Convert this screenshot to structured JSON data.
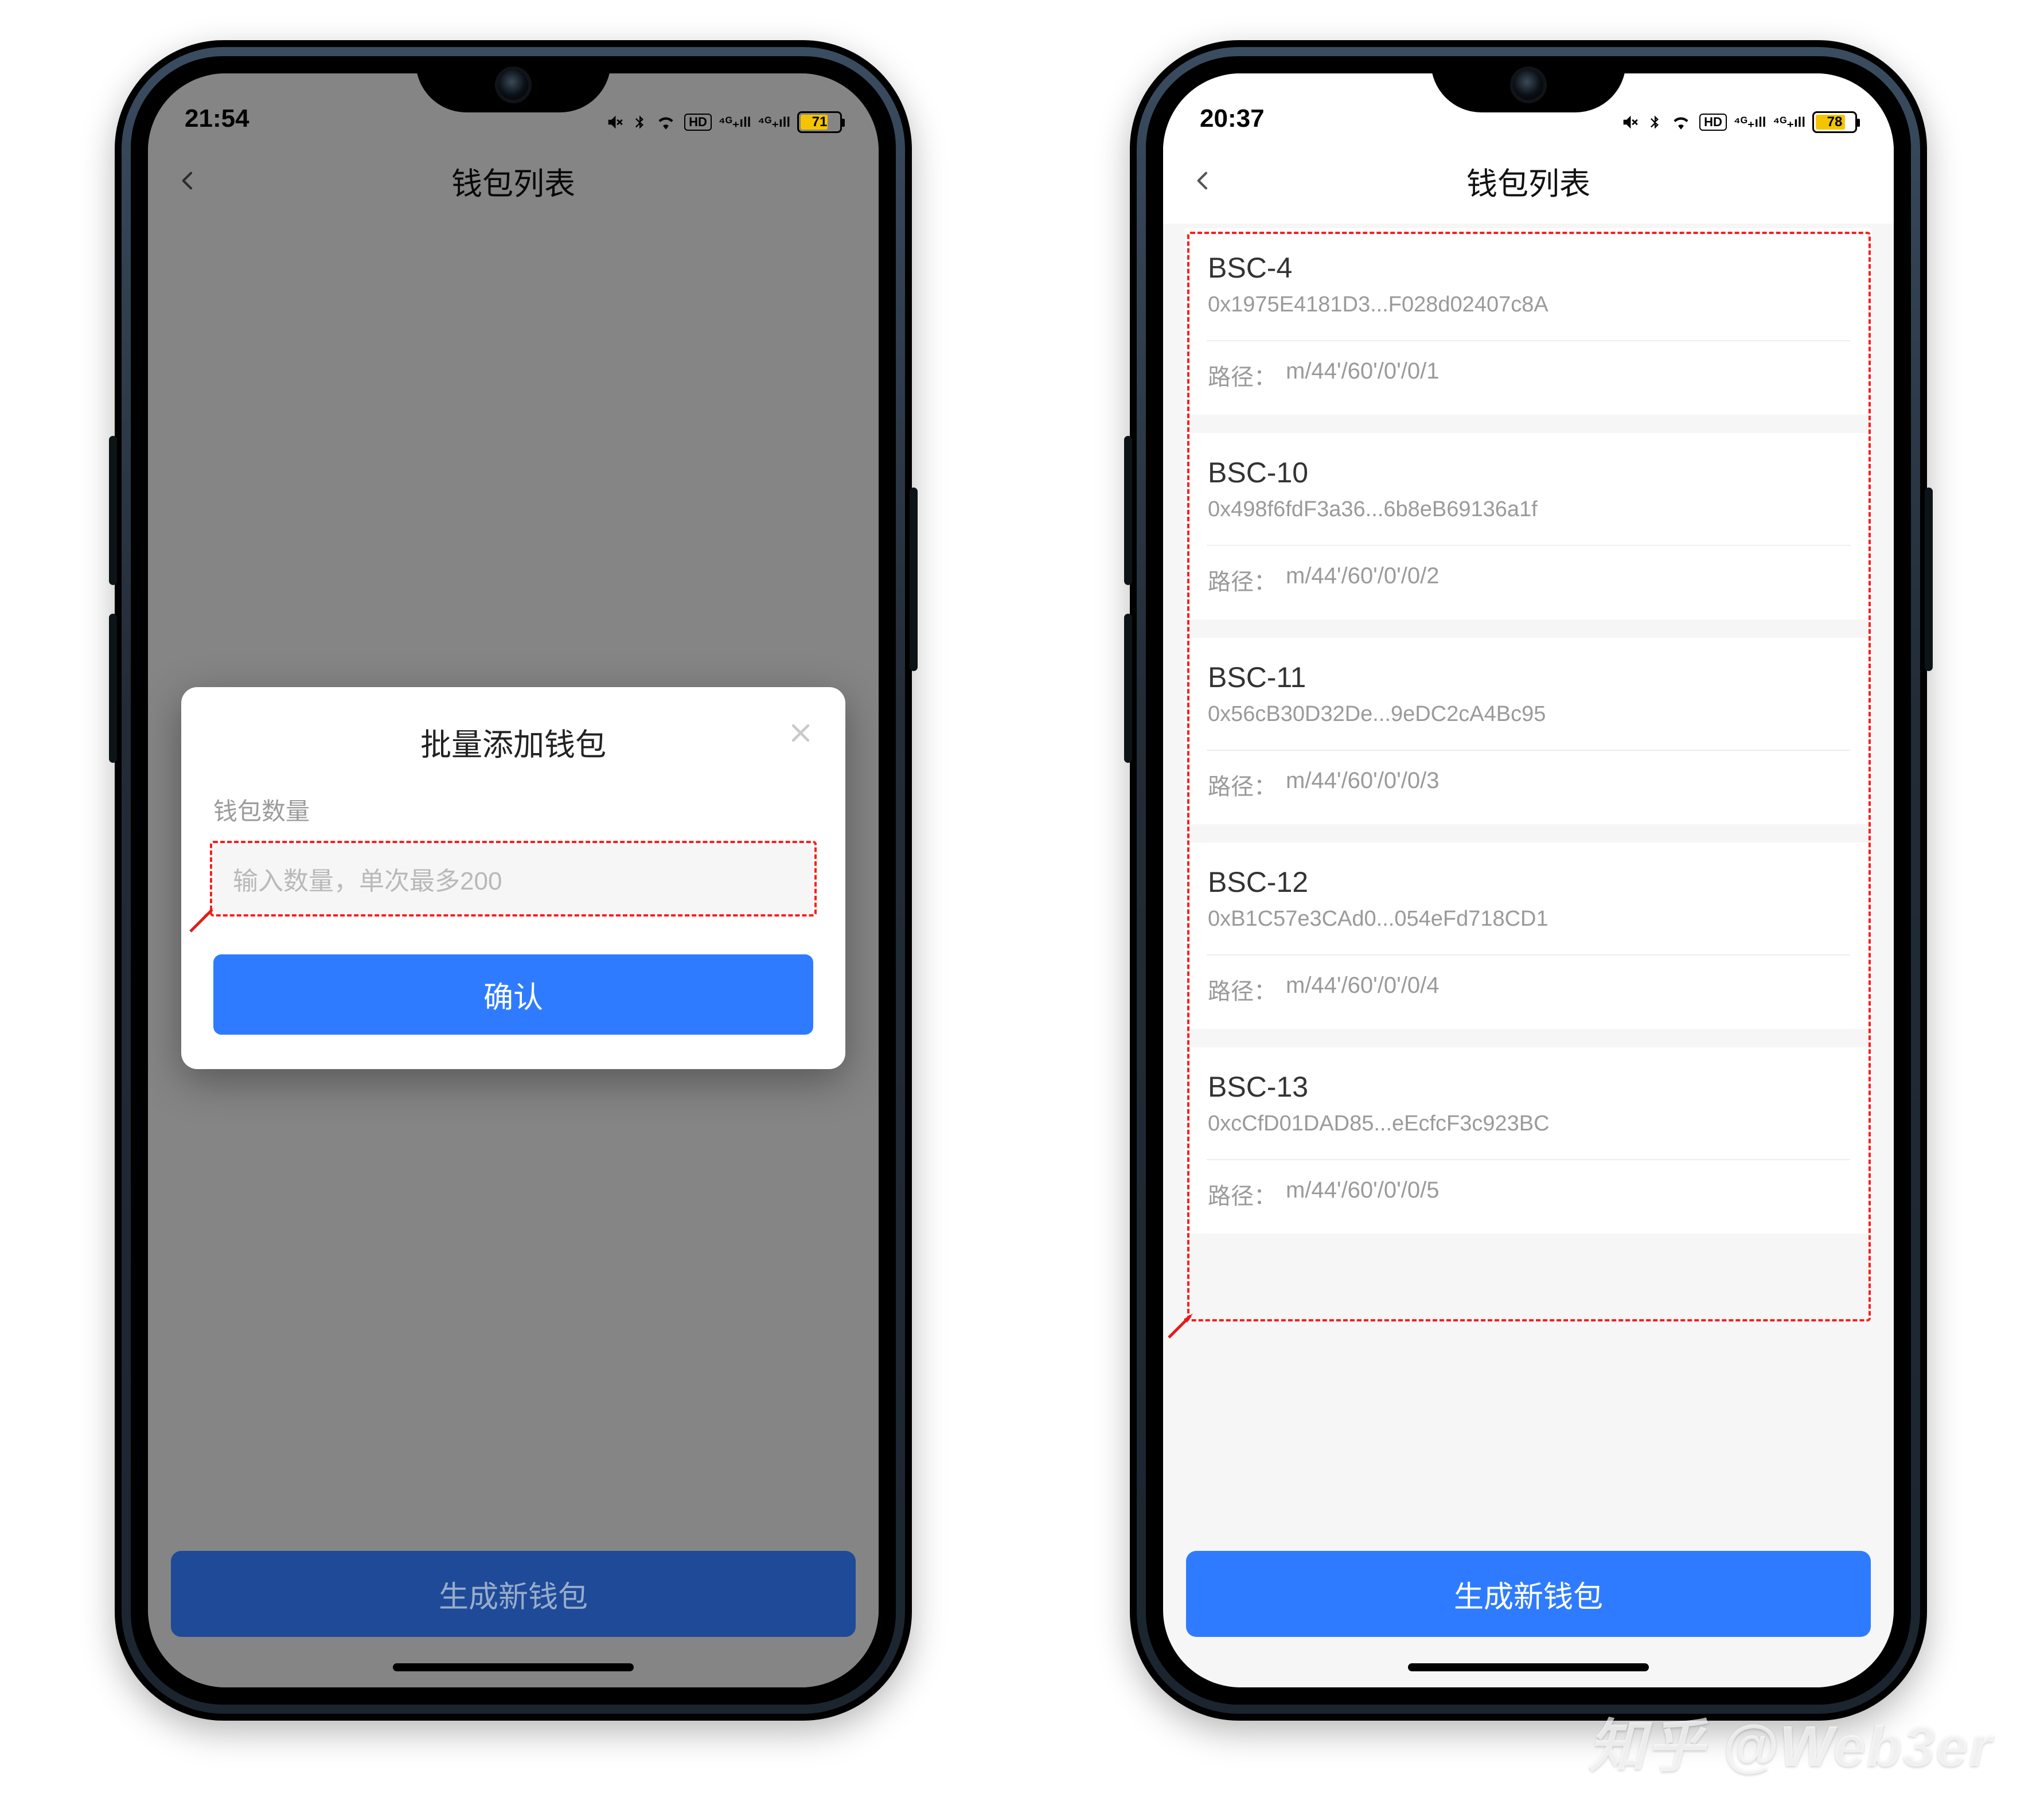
{
  "watermark": "知乎 @Web3er",
  "phone1": {
    "status": {
      "time": "21:54",
      "battery": "71",
      "battery_pct": 71
    },
    "nav": {
      "title": "钱包列表"
    },
    "footer_btn": "生成新钱包",
    "modal": {
      "title": "批量添加钱包",
      "label": "钱包数量",
      "placeholder": "输入数量，单次最多200",
      "confirm": "确认"
    }
  },
  "phone2": {
    "status": {
      "time": "20:37",
      "battery": "78",
      "battery_pct": 78
    },
    "nav": {
      "title": "钱包列表"
    },
    "footer_btn": "生成新钱包",
    "path_label": "路径：",
    "wallets": [
      {
        "name": "BSC-4",
        "addr": "0x1975E4181D3...F028d02407c8A",
        "path": "m/44'/60'/0'/0/1"
      },
      {
        "name": "BSC-10",
        "addr": "0x498f6fdF3a36...6b8eB69136a1f",
        "path": "m/44'/60'/0'/0/2"
      },
      {
        "name": "BSC-11",
        "addr": "0x56cB30D32De...9eDC2cA4Bc95",
        "path": "m/44'/60'/0'/0/3"
      },
      {
        "name": "BSC-12",
        "addr": "0xB1C57e3CAd0...054eFd718CD1",
        "path": "m/44'/60'/0'/0/4"
      },
      {
        "name": "BSC-13",
        "addr": "0xcCfD01DAD85...eEcfcF3c923BC",
        "path": "m/44'/60'/0'/0/5"
      }
    ]
  }
}
